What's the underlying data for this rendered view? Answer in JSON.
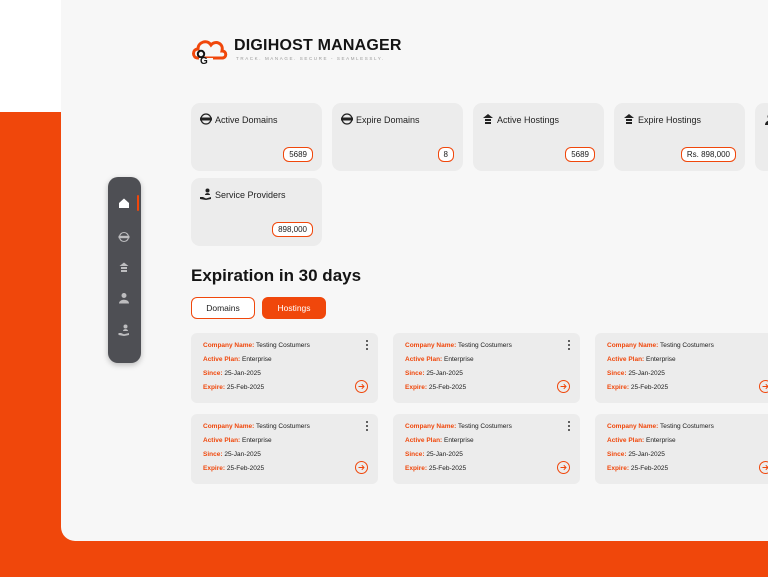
{
  "app": {
    "title": "DIGIHOST MANAGER",
    "tagline": "TRACK. MANAGE. SECURE - SEAMLESSLY.",
    "accent_color": "#f0470b"
  },
  "stats": [
    {
      "label": "Active Domains",
      "value": "5689",
      "icon": "www-globe-icon"
    },
    {
      "label": "Expire Domains",
      "value": "8",
      "icon": "www-globe-icon"
    },
    {
      "label": "Active Hostings",
      "value": "5689",
      "icon": "cloud-server-icon"
    },
    {
      "label": "Expire Hostings",
      "value": "Rs. 898,000",
      "icon": "cloud-server-icon"
    },
    {
      "label": "Service Providers",
      "value": "898,000",
      "icon": "hand-user-icon"
    }
  ],
  "sidebar": {
    "items": [
      {
        "name": "home-icon",
        "active": true
      },
      {
        "name": "www-globe-icon",
        "active": false
      },
      {
        "name": "cloud-server-icon",
        "active": false
      },
      {
        "name": "user-icon",
        "active": false
      },
      {
        "name": "hand-user-icon",
        "active": false
      }
    ]
  },
  "section": {
    "title": "Expiration in 30 days",
    "tabs": [
      {
        "label": "Domains",
        "selected": false
      },
      {
        "label": "Hostings",
        "selected": true
      }
    ]
  },
  "expirations": {
    "labels": {
      "company": "Company Name:",
      "plan": "Active Plan:",
      "since": "Since:",
      "expire": "Expire:"
    },
    "cards": [
      {
        "company": "Testing Costumers",
        "plan": "Enterprise",
        "since": "25-Jan-2025",
        "expire": "25-Feb-2025"
      },
      {
        "company": "Testing Costumers",
        "plan": "Enterprise",
        "since": "25-Jan-2025",
        "expire": "25-Feb-2025"
      },
      {
        "company": "Testing Costumers",
        "plan": "Enterprise",
        "since": "25-Jan-2025",
        "expire": "25-Feb-2025"
      },
      {
        "company": "Testing Costumers",
        "plan": "Enterprise",
        "since": "25-Jan-2025",
        "expire": "25-Feb-2025"
      },
      {
        "company": "Testing Costumers",
        "plan": "Enterprise",
        "since": "25-Jan-2025",
        "expire": "25-Feb-2025"
      },
      {
        "company": "Testing Costumers",
        "plan": "Enterprise",
        "since": "25-Jan-2025",
        "expire": "25-Feb-2025"
      }
    ]
  }
}
